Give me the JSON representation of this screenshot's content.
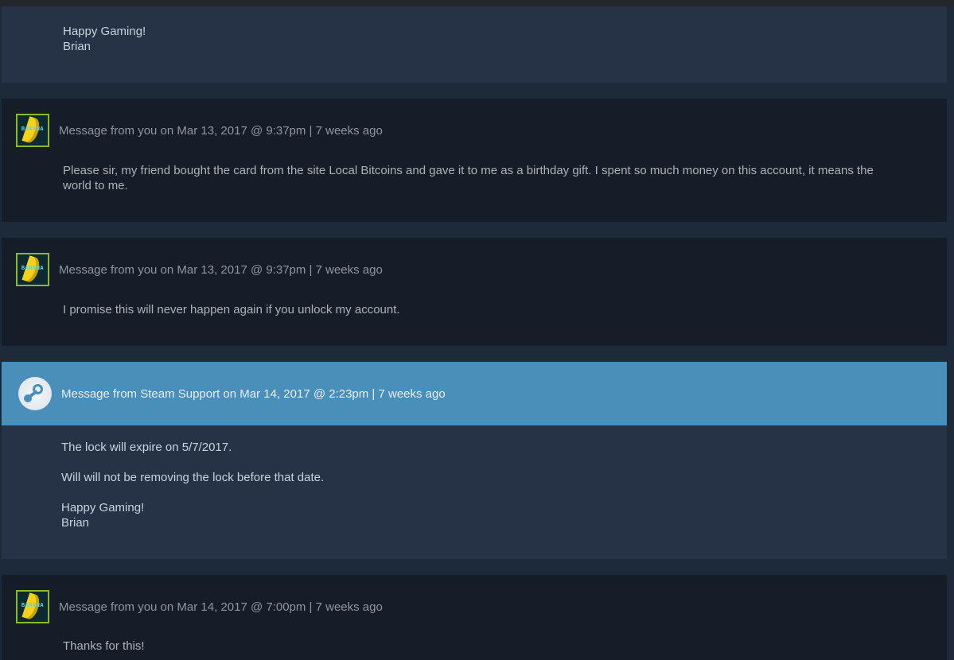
{
  "messages": [
    {
      "type": "support",
      "partial": true,
      "closing": "Happy Gaming!",
      "signature": "Brian"
    },
    {
      "type": "user",
      "avatar": "banana-avatar",
      "avatar_text": "BANANA",
      "meta": "Message from you on Mar 13, 2017 @ 9:37pm | 7 weeks ago",
      "body": "Please sir, my friend bought the card from the site Local Bitcoins and gave it to me as a birthday gift. I spent so much money on this account, it means the world to me."
    },
    {
      "type": "user",
      "avatar": "banana-avatar",
      "avatar_text": "BANANA",
      "meta": "Message from you on Mar 13, 2017 @ 9:37pm | 7 weeks ago",
      "body": "I promise this will never happen again if you unlock my account."
    },
    {
      "type": "support",
      "avatar": "steam-logo-icon",
      "meta": "Message from Steam Support on Mar 14, 2017 @ 2:23pm | 7 weeks ago",
      "paragraphs": [
        "The lock will expire on 5/7/2017.",
        "Will will not be removing the lock before that date."
      ],
      "closing": "Happy Gaming!",
      "signature": "Brian"
    },
    {
      "type": "user",
      "avatar": "banana-avatar",
      "avatar_text": "BANANA",
      "meta": "Message from you on Mar 14, 2017 @ 7:00pm | 7 weeks ago",
      "body": "Thanks for this!"
    }
  ],
  "colors": {
    "support_header": "#4a8fb9",
    "support_body": "#263245",
    "user_block": "#141d28",
    "page_background": "#1c2a3a"
  }
}
